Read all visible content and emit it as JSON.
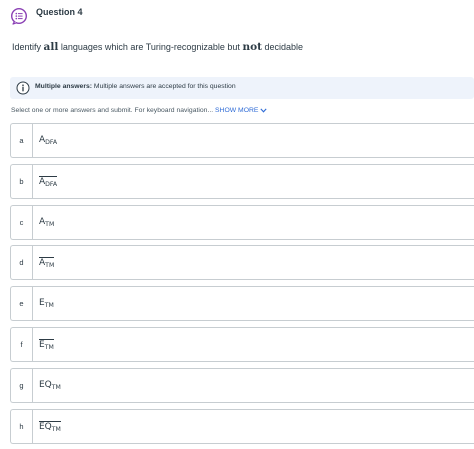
{
  "question": {
    "title": "Question 4",
    "prompt_pre": "Identify ",
    "prompt_em1": "all",
    "prompt_mid": " languages which are Turing-recognizable but ",
    "prompt_em2": "not",
    "prompt_post": " decidable"
  },
  "info": {
    "label": "Multiple answers:",
    "text": " Multiple answers are accepted for this question"
  },
  "instructions": {
    "text": "Select one or more answers and submit. For keyboard navigation...",
    "show_more": "SHOW MORE"
  },
  "options": [
    {
      "letter": "a",
      "base": "A",
      "sub": "DFA",
      "complement": false
    },
    {
      "letter": "b",
      "base": "A",
      "sub": "DFA",
      "complement": true
    },
    {
      "letter": "c",
      "base": "A",
      "sub": "TM",
      "complement": false
    },
    {
      "letter": "d",
      "base": "A",
      "sub": "TM",
      "complement": true
    },
    {
      "letter": "e",
      "base": "E",
      "sub": "TM",
      "complement": false
    },
    {
      "letter": "f",
      "base": "E",
      "sub": "TM",
      "complement": true
    },
    {
      "letter": "g",
      "base": "EQ",
      "sub": "TM",
      "complement": false
    },
    {
      "letter": "h",
      "base": "EQ",
      "sub": "TM",
      "complement": true
    }
  ],
  "colors": {
    "accent": "#2e6bd6",
    "icon_purple": "#8a3fb4",
    "info_bg": "#eef3fb",
    "border": "#c7cdd1",
    "text": "#2d3b45"
  },
  "icons": {
    "question": "list-bubble-icon",
    "info": "info-circle-icon",
    "show_more": "chevron-down-icon"
  }
}
